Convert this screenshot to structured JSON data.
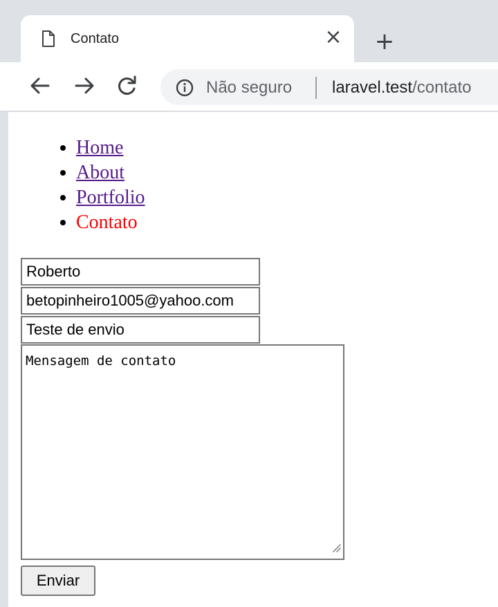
{
  "browser": {
    "tab": {
      "title": "Contato",
      "close_glyph": "×"
    },
    "new_tab_glyph": "+",
    "omnibox": {
      "security_label": "Não seguro",
      "url_host": "laravel.test",
      "url_path": "/contato"
    },
    "icons": [
      "page-icon",
      "back-arrow-icon",
      "forward-arrow-icon",
      "reload-icon",
      "info-icon"
    ]
  },
  "nav": {
    "items": [
      {
        "label": "Home",
        "link": true
      },
      {
        "label": "About",
        "link": true
      },
      {
        "label": "Portfolio",
        "link": true
      },
      {
        "label": "Contato",
        "link": false,
        "active": true
      }
    ],
    "active_color": "#ff0000",
    "link_color": "#551a8b"
  },
  "form": {
    "name_value": "Roberto",
    "email_value": "betopinheiro1005@yahoo.com",
    "subject_value": "Teste de envio",
    "message_value": "Mensagem de contato",
    "submit_label": "Enviar"
  }
}
